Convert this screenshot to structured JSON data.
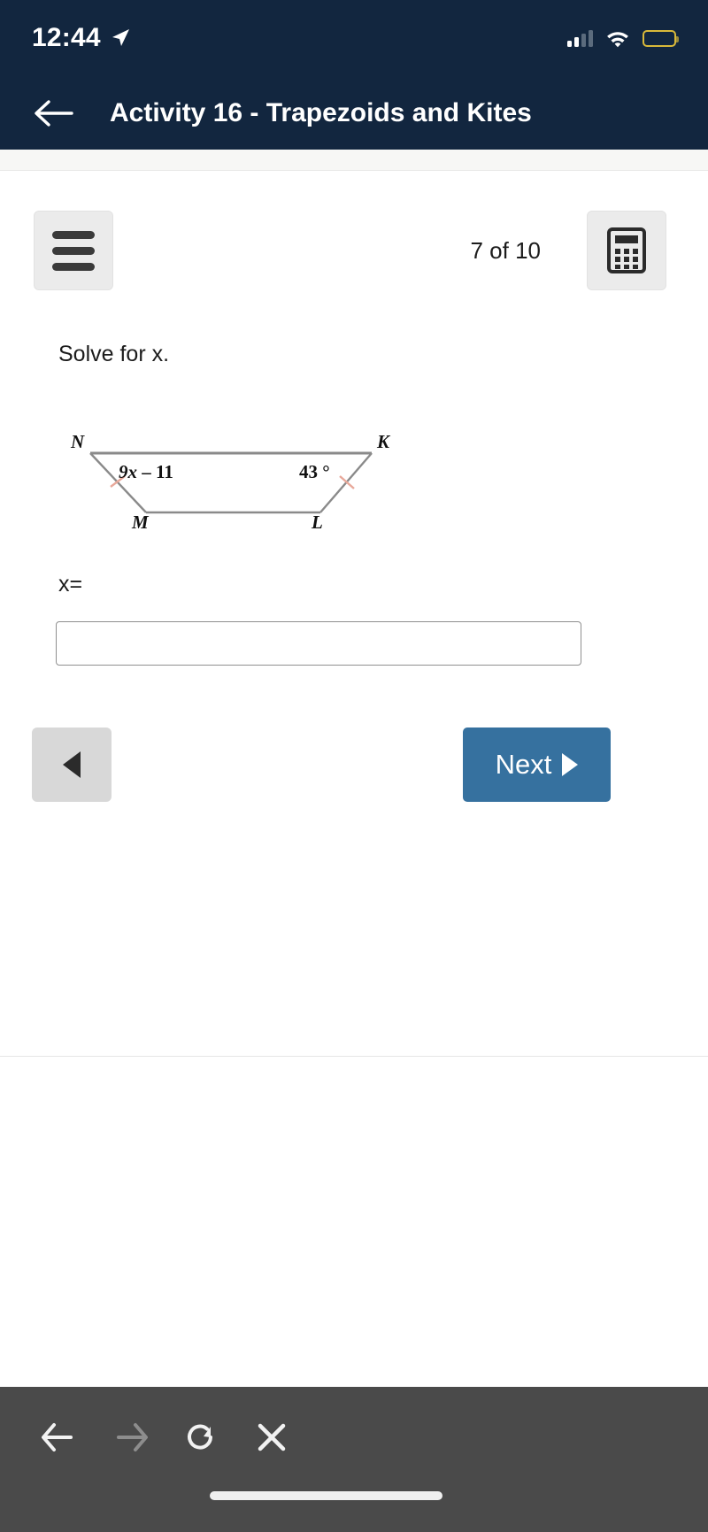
{
  "status_bar": {
    "time": "12:44",
    "location_icon": "location-arrow-icon",
    "signal_icon": "cellular-bars-icon",
    "wifi_icon": "wifi-icon",
    "battery_icon": "battery-icon",
    "battery_color": "#ffd83d",
    "bars_filled": 2,
    "bars_total": 4
  },
  "header": {
    "back_icon": "back-arrow-icon",
    "title": "Activity 16 - Trapezoids and Kites",
    "background_color": "#12263f"
  },
  "toolbar": {
    "menu_icon": "hamburger-menu-icon",
    "calculator_icon": "calculator-icon",
    "progress": "7 of 10"
  },
  "question": {
    "prompt": "Solve for x.",
    "answer_label": "x=",
    "answer_value": "",
    "answer_placeholder": ""
  },
  "figure": {
    "type": "trapezoid",
    "vertices": [
      "N",
      "K",
      "M",
      "L"
    ],
    "vertex_N": "N",
    "vertex_K": "K",
    "vertex_M": "M",
    "vertex_L": "L",
    "angle_left_label": "9x – 11",
    "angle_right_label": "43 °",
    "tick_mark_color": "#e8a89a",
    "stroke_color": "#8a8a8a"
  },
  "navigation": {
    "prev_icon": "triangle-left-icon",
    "next_label": "Next",
    "next_icon": "triangle-right-icon",
    "next_color": "#36719f",
    "prev_color": "#d8d8d8"
  },
  "browser_bar": {
    "back_icon": "arrow-left-icon",
    "forward_icon": "arrow-right-icon",
    "reload_icon": "reload-icon",
    "close_icon": "close-x-icon",
    "home_indicator": "home-indicator",
    "background_color": "#4a4a4a"
  }
}
